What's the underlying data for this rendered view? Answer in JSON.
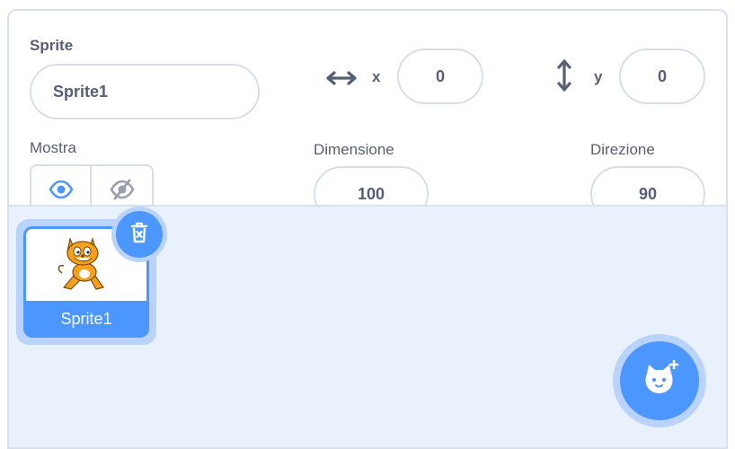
{
  "sprite_info": {
    "sprite_label": "Sprite",
    "sprite_name_value": "Sprite1",
    "x_label": "x",
    "x_value": "0",
    "y_label": "y",
    "y_value": "0",
    "show_label": "Mostra",
    "size_label": "Dimensione",
    "size_value": "100",
    "direction_label": "Direzione",
    "direction_value": "90"
  },
  "sprites": [
    {
      "name": "Sprite1",
      "selected": true
    }
  ],
  "icons": {
    "x_axis": "horizontal-arrows-icon",
    "y_axis": "vertical-arrows-icon",
    "show": "eye-icon",
    "hide": "eye-slash-icon",
    "delete": "trash-icon",
    "add_sprite": "add-sprite-cat-icon"
  },
  "colors": {
    "accent": "#4c97ff",
    "accent_light": "#b9d3fa",
    "text": "#575e75",
    "panel_bg": "#e9f1fc",
    "border": "#d9dee6"
  }
}
